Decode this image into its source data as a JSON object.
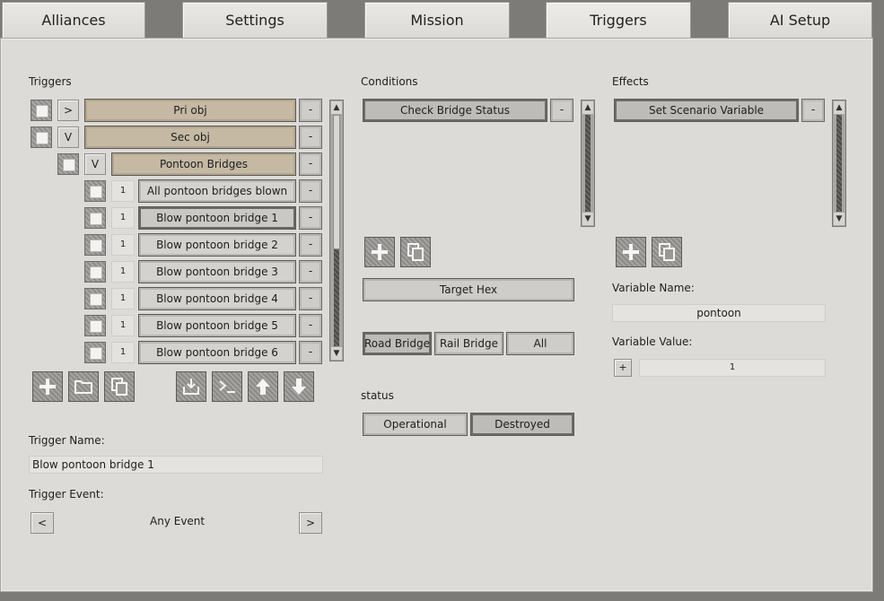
{
  "tabs": [
    {
      "label": "Alliances"
    },
    {
      "label": "Settings"
    },
    {
      "label": "Mission"
    },
    {
      "label": "Triggers"
    },
    {
      "label": "AI Setup"
    }
  ],
  "triggers": {
    "heading": "Triggers",
    "rows": [
      {
        "toggle": ">",
        "label": "Pri obj",
        "dash": "-"
      },
      {
        "toggle": "V",
        "label": "Sec obj",
        "dash": "-"
      },
      {
        "toggle": "V",
        "label": "Pontoon Bridges",
        "dash": "-"
      },
      {
        "num": "1",
        "label": "All pontoon bridges blown",
        "dash": "-"
      },
      {
        "num": "1",
        "label": "Blow pontoon bridge 1",
        "dash": "-"
      },
      {
        "num": "1",
        "label": "Blow pontoon bridge 2",
        "dash": "-"
      },
      {
        "num": "1",
        "label": "Blow pontoon bridge 3",
        "dash": "-"
      },
      {
        "num": "1",
        "label": "Blow pontoon bridge 4",
        "dash": "-"
      },
      {
        "num": "1",
        "label": "Blow pontoon bridge 5",
        "dash": "-"
      },
      {
        "num": "1",
        "label": "Blow pontoon bridge 6",
        "dash": "-"
      }
    ],
    "trigger_name_label": "Trigger Name:",
    "trigger_name_value": "Blow pontoon bridge 1",
    "trigger_event_label": "Trigger Event:",
    "event_prev": "<",
    "event_next": ">",
    "event_value": "Any Event"
  },
  "conditions": {
    "heading": "Conditions",
    "item": "Check Bridge Status",
    "dash": "-",
    "target_hex": "Target Hex",
    "bridge_types": [
      "Road Bridge",
      "Rail Bridge",
      "All"
    ],
    "status_label": "status",
    "status_options": [
      "Operational",
      "Destroyed"
    ]
  },
  "effects": {
    "heading": "Effects",
    "item": "Set Scenario Variable",
    "dash": "-",
    "var_name_label": "Variable Name:",
    "var_name_value": "pontoon",
    "var_value_label": "Variable Value:",
    "var_op": "+",
    "var_value": "1"
  },
  "colors": {
    "folder": "#c5b9a4",
    "panel": "#dddbd7",
    "frame": "#7d7b77"
  }
}
